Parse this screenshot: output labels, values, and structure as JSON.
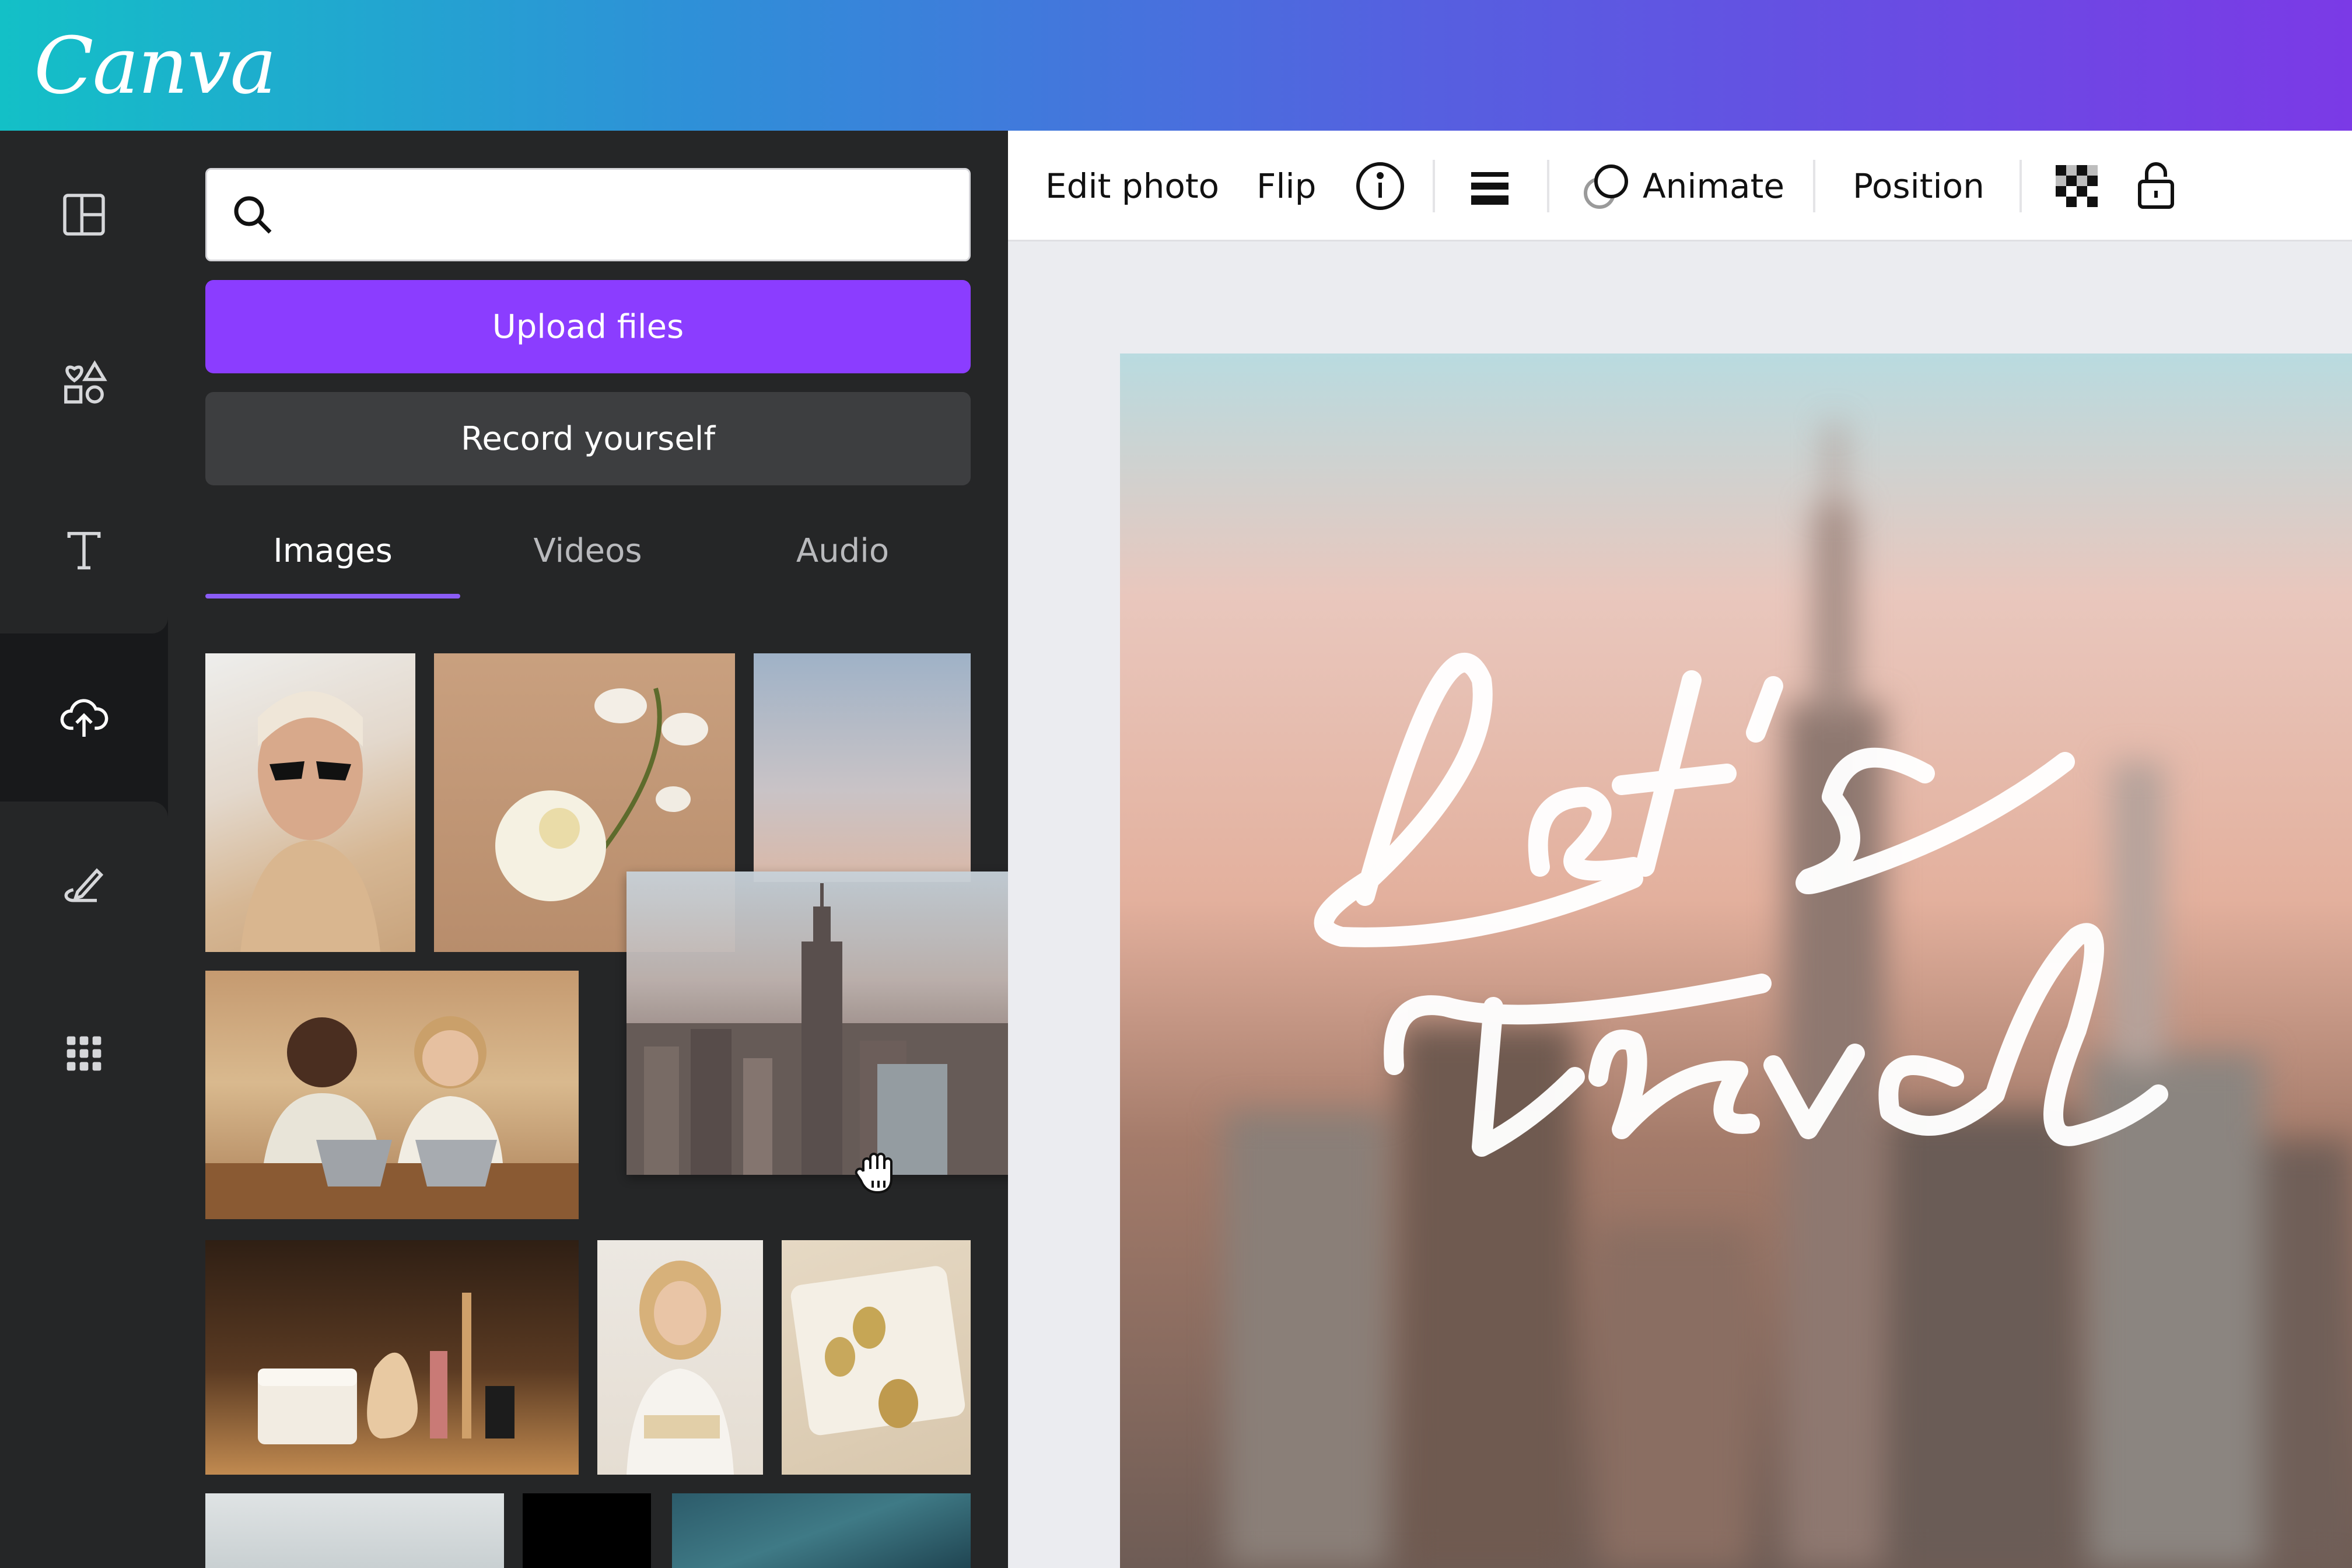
{
  "brand": {
    "logo_text": "Canva"
  },
  "rail": {
    "items": [
      {
        "icon": "layout-template-icon"
      },
      {
        "icon": "elements-shapes-icon"
      },
      {
        "icon": "text-icon"
      },
      {
        "icon": "upload-cloud-icon",
        "active": true
      },
      {
        "icon": "draw-pen-icon"
      },
      {
        "icon": "apps-grid-icon"
      }
    ]
  },
  "panel": {
    "search": {
      "value": "",
      "placeholder": ""
    },
    "upload_label": "Upload files",
    "record_label": "Record yourself",
    "tabs": [
      "Images",
      "Videos",
      "Audio"
    ],
    "active_tab": "Images"
  },
  "toolbar": {
    "edit_photo": "Edit photo",
    "flip": "Flip",
    "animate": "Animate",
    "position": "Position"
  },
  "design": {
    "text_line1": "Let's",
    "text_line2": "travel"
  },
  "colors": {
    "accent": "#8b3dff",
    "panel_bg": "#252627",
    "rail_bg": "#18191b"
  }
}
